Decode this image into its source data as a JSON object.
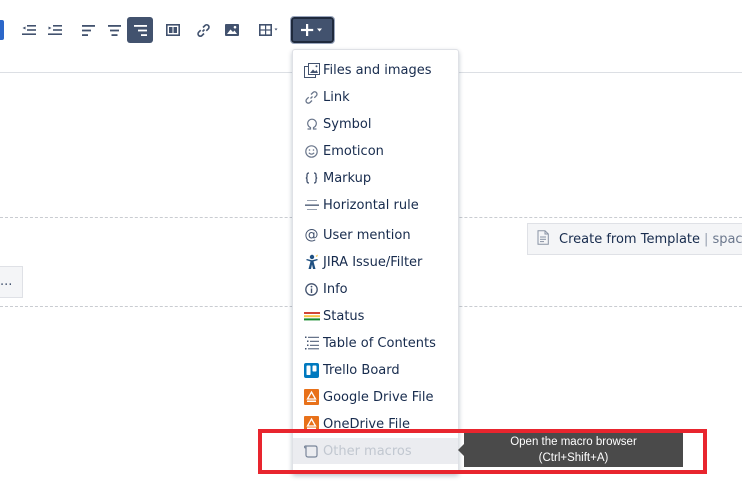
{
  "toolbar": {
    "buttons": [
      {
        "name": "outdent-button",
        "icon": "outdent-icon"
      },
      {
        "name": "indent-button",
        "icon": "indent-icon"
      },
      {
        "name": "align-left-button",
        "icon": "align-left-icon"
      },
      {
        "name": "align-center-button",
        "icon": "align-center-icon"
      },
      {
        "name": "align-right-button",
        "icon": "align-right-icon",
        "active": true
      },
      {
        "name": "page-layout-button",
        "icon": "layout-icon"
      },
      {
        "name": "insert-link-button",
        "icon": "link-icon"
      },
      {
        "name": "insert-image-button",
        "icon": "image-icon"
      },
      {
        "name": "insert-table-button",
        "icon": "table-icon"
      },
      {
        "name": "insert-more-button",
        "icon": "plus-icon",
        "expanded": true
      }
    ]
  },
  "editor": {
    "ellipsis": "...",
    "template_button": {
      "label": "Create from Template",
      "separator": "|",
      "suffix": "space"
    }
  },
  "insert_menu": {
    "items": [
      {
        "label": "Files and images",
        "icon": "files-images-icon"
      },
      {
        "label": "Link",
        "icon": "link-icon"
      },
      {
        "label": "Symbol",
        "icon": "omega-icon"
      },
      {
        "label": "Emoticon",
        "icon": "smiley-icon"
      },
      {
        "label": "Markup",
        "icon": "braces-icon"
      },
      {
        "label": "Horizontal rule",
        "icon": "horizontal-rule-icon"
      },
      {
        "label": "User mention",
        "icon": "at-icon"
      },
      {
        "label": "JIRA Issue/Filter",
        "icon": "jira-icon"
      },
      {
        "label": "Info",
        "icon": "info-icon"
      },
      {
        "label": "Status",
        "icon": "status-icon"
      },
      {
        "label": "Table of Contents",
        "icon": "toc-icon"
      },
      {
        "label": "Trello Board",
        "icon": "trello-icon"
      },
      {
        "label": "Google Drive File",
        "icon": "google-drive-icon"
      },
      {
        "label": "OneDrive File",
        "icon": "onedrive-icon"
      },
      {
        "label": "Other macros",
        "icon": "macro-icon",
        "hovered": true
      }
    ]
  },
  "tooltip": {
    "line1": "Open the macro browser",
    "line2": "(Ctrl+Shift+A)"
  },
  "colors": {
    "toolbar_active": "#42526e",
    "highlight_border": "#e8252e",
    "tooltip_bg": "#4a4a4a",
    "trello_blue": "#0079bf",
    "drive_orange": "#e8711a"
  }
}
